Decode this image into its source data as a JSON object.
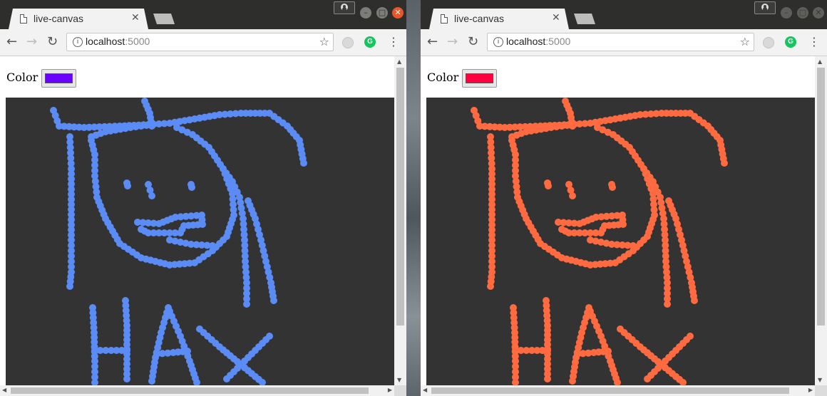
{
  "windows": [
    {
      "tab_title": "live-canvas",
      "url_host": "localhost",
      "url_port": ":5000",
      "color_label": "Color :",
      "picker_color": "#6a00ff",
      "stroke_color": "#5b8cf5"
    },
    {
      "tab_title": "live-canvas",
      "url_host": "localhost",
      "url_port": ":5000",
      "color_label": "Color :",
      "picker_color": "#ff0040",
      "stroke_color": "#ff6a40"
    }
  ],
  "icons": {
    "tab": "page-icon",
    "close": "close-icon",
    "back": "back-arrow-icon",
    "forward": "forward-arrow-icon",
    "reload": "reload-icon",
    "info": "info-icon",
    "bookmark": "star-icon",
    "menu": "kebab-menu-icon",
    "extension_grammarly": "grammarly-icon",
    "profile": "profile-icon"
  }
}
